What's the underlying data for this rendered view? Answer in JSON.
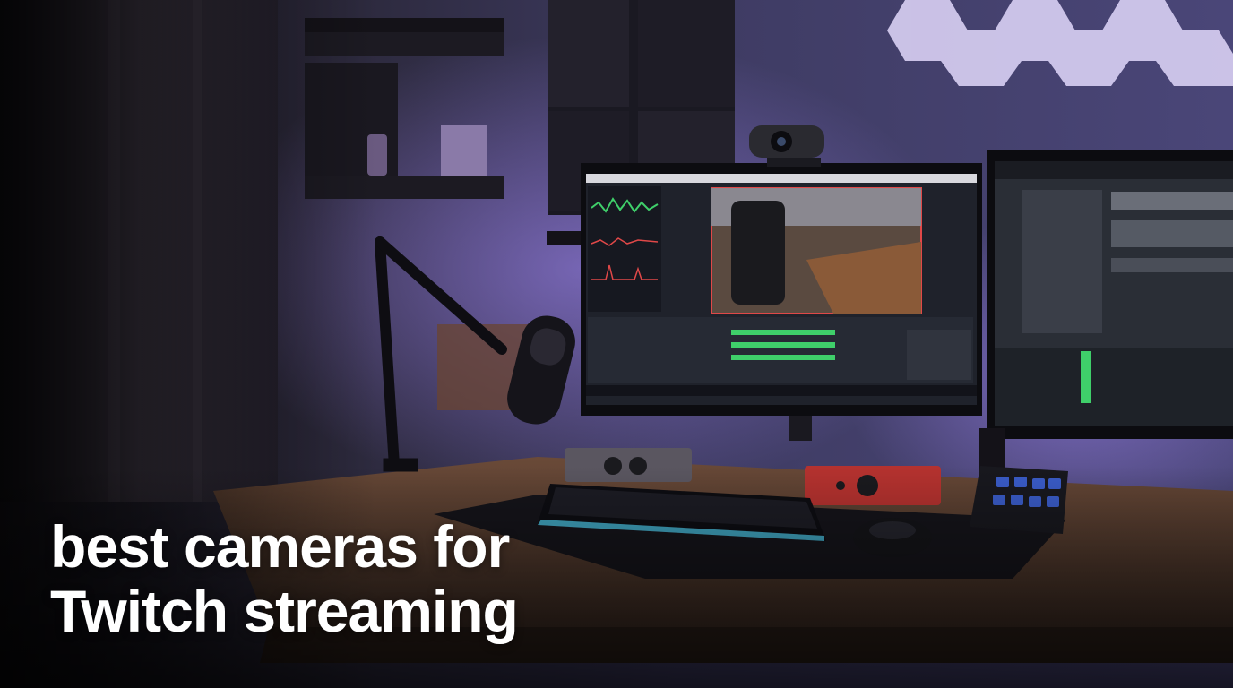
{
  "headline": {
    "line1": "best cameras for",
    "line2": "Twitch streaming"
  },
  "colors": {
    "wall": "#3c3a5e",
    "ambient_purple": "#8b6dd8",
    "desk_wood": "#5a3e2e",
    "screen_bg": "#1f222b",
    "accent_green": "#3fcf6a",
    "accent_red": "#e04848",
    "interface_red": "#b5322f",
    "text": "#ffffff"
  }
}
